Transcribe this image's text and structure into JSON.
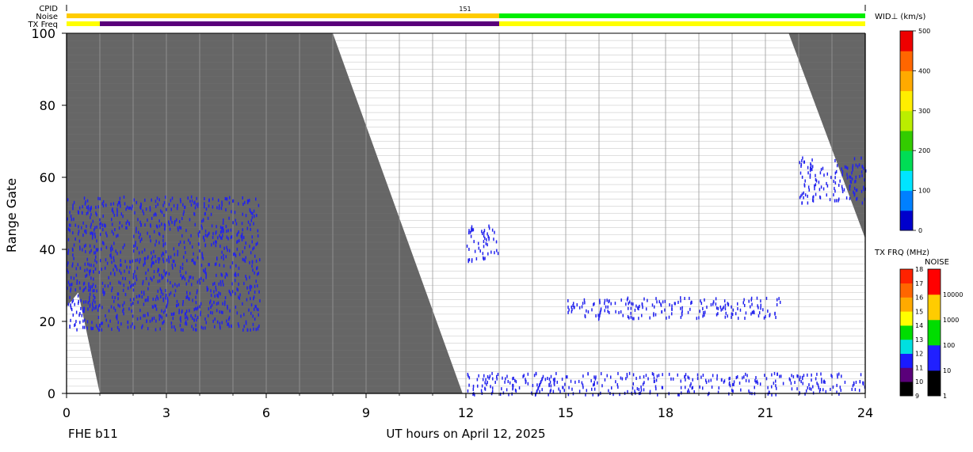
{
  "header": {
    "cpid_label": "CPID",
    "noise_label": "Noise",
    "txfreq_label": "TX Freq",
    "cpid_value": "151"
  },
  "chart_data": {
    "type": "heatmap",
    "title": "",
    "xlabel": "UT hours on April 12, 2025",
    "ylabel": "Range Gate",
    "xlim": [
      0,
      24
    ],
    "ylim": [
      0,
      100
    ],
    "xticks": [
      0,
      3,
      6,
      9,
      12,
      15,
      18,
      21,
      24
    ],
    "yticks": [
      0,
      20,
      40,
      60,
      80,
      100
    ],
    "station_label": "FHE b11",
    "grid": "vertical lines every hour",
    "ground_scatter_color": "#666666",
    "velocity_width_color": "#2222ee",
    "terminator_bands": [
      {
        "name": "",
        "top_start_hr": 0.0,
        "top_end_hr": 8.0,
        "bottom_end_hr": 12.0,
        "note": "dark region left of sloped edge; edge goes from (8,100) to (11.9,0)"
      },
      {
        "name": "",
        "top_start_hr": 21.7,
        "bottom_start_hr": 24.0,
        "note": "dark wedge from (21.7,100) to (24,43)"
      }
    ],
    "data_regions": [
      {
        "name": "",
        "x_start": 0.0,
        "x_end": 5.8,
        "y_low": 18,
        "y_high": 55
      },
      {
        "name": "",
        "x_start": 12.0,
        "x_end": 13.0,
        "y_low": 37,
        "y_high": 47
      },
      {
        "name": "",
        "x_start": 15.0,
        "x_end": 21.5,
        "y_low": 21,
        "y_high": 27
      },
      {
        "name": "",
        "x_start": 22.0,
        "x_end": 24.0,
        "y_low": 53,
        "y_high": 66
      },
      {
        "name": "",
        "x_start": 12.0,
        "x_end": 24.0,
        "y_low": 0,
        "y_high": 6
      }
    ],
    "colorbar_width": {
      "label": "WID⊥ (km/s)",
      "ticks": [
        0,
        100,
        200,
        300,
        400,
        500
      ]
    },
    "colorbar_freq": {
      "label": "TX FRQ (MHz)",
      "ticks": [
        9,
        10,
        11,
        12,
        13,
        14,
        15,
        16,
        17,
        18
      ],
      "colors": [
        "#000000",
        "#5a007a",
        "#1a1aff",
        "#00e0e0",
        "#00dd00",
        "#ffff00",
        "#ffaa00",
        "#ff6600",
        "#ff2200",
        "#dd0000"
      ]
    },
    "colorbar_noise": {
      "label": "NOISE",
      "ticks": [
        "1",
        "10",
        "100",
        "1000",
        "10000"
      ],
      "colors": [
        "#000000",
        "#2020ff",
        "#00dd00",
        "#ffcc00",
        "#ff0000"
      ]
    },
    "top_strip": {
      "noise_colors": [
        "#ffcc00",
        "#00ee00"
      ],
      "noise_switch_hr": 13.0,
      "freq_colors": [
        "#ffff00",
        "#5a007a"
      ],
      "freq_purple_start_hr": 1.0,
      "freq_purple_end_hr": 13.0
    }
  }
}
